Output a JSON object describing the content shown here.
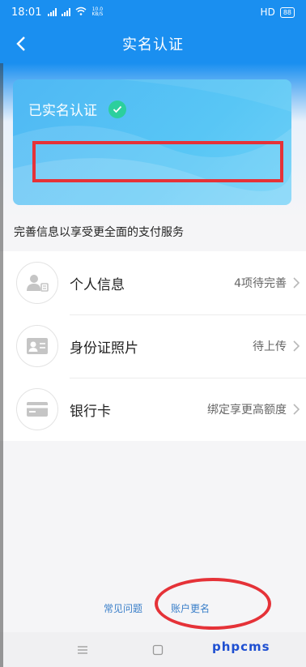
{
  "status_bar": {
    "time": "18:01",
    "network_speed": "10.0",
    "network_unit": "KB/S",
    "hd": "HD",
    "battery": "88"
  },
  "header": {
    "title": "实名认证"
  },
  "card": {
    "status": "已实名认证"
  },
  "section": {
    "title": "完善信息以享受更全面的支付服务"
  },
  "list": {
    "items": [
      {
        "label": "个人信息",
        "status": "4项待完善",
        "icon": "person-id-icon"
      },
      {
        "label": "身份证照片",
        "status": "待上传",
        "icon": "id-card-icon"
      },
      {
        "label": "银行卡",
        "status": "绑定享更高额度",
        "icon": "bank-card-icon"
      }
    ]
  },
  "footer": {
    "faq": "常见问题",
    "rename": "账户更名"
  },
  "watermark": "phpcms",
  "colors": {
    "brand": "#1a8ff0",
    "card": "#58c6f5",
    "check": "#2ccf9d",
    "annotation": "#e53238",
    "link": "#3a7fc9"
  }
}
